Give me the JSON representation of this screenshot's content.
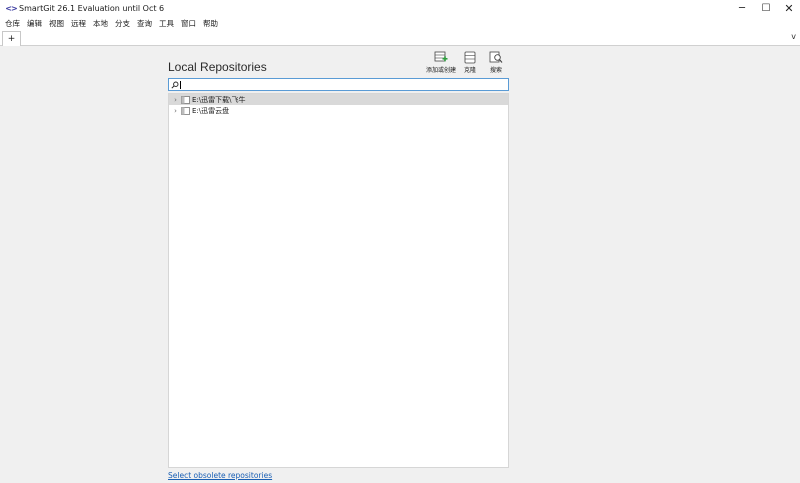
{
  "window": {
    "title": "SmartGit 26.1 Evaluation until Oct 6",
    "app_icon": "smartgit-icon",
    "controls": {
      "minimize": "─",
      "maximize": "☐",
      "close": "✕"
    }
  },
  "menu": {
    "items": [
      {
        "label": "仓库"
      },
      {
        "label": "编辑"
      },
      {
        "label": "视图"
      },
      {
        "label": "远程"
      },
      {
        "label": "本地"
      },
      {
        "label": "分支"
      },
      {
        "label": "查询"
      },
      {
        "label": "工具"
      },
      {
        "label": "窗口"
      },
      {
        "label": "帮助"
      }
    ]
  },
  "tabs": {
    "add_label": "+",
    "overflow": "v"
  },
  "panel": {
    "title": "Local Repositories",
    "toolbar": {
      "add_label": "添加或创建",
      "clone_label": "克隆",
      "search_label": "搜索"
    },
    "search": {
      "value": "",
      "placeholder": ""
    }
  },
  "repositories": [
    {
      "name": "E:\\迅雷下载\\飞牛",
      "selected": true
    },
    {
      "name": "E:\\迅雷云盘",
      "selected": false
    }
  ],
  "footer": {
    "obsolete_link": "Select obsolete repositories"
  },
  "colors": {
    "accent": "#5a9bd5",
    "selection": "#d9d9d9",
    "link": "#1a5fb4",
    "add_icon_green": "#2e9e3e"
  }
}
